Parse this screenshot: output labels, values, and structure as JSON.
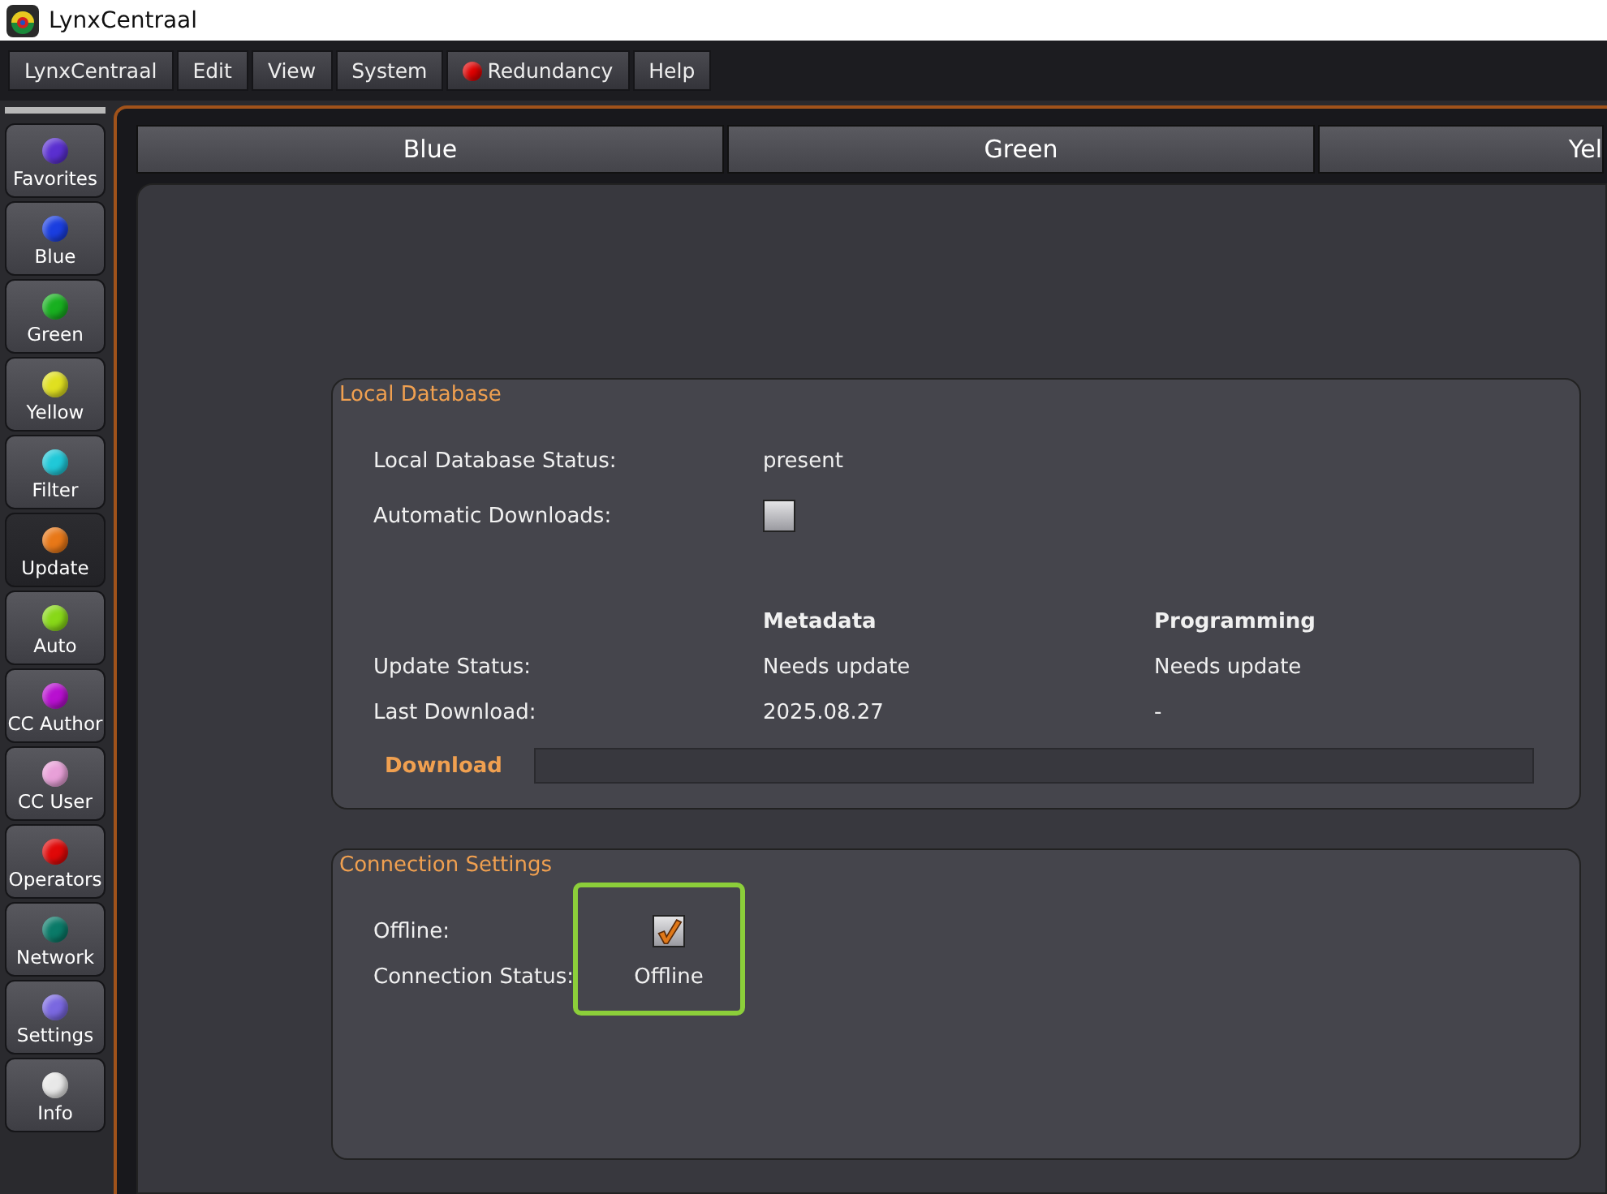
{
  "window": {
    "title": "LynxCentraal"
  },
  "menu": [
    {
      "label": "LynxCentraal",
      "kind": "plain"
    },
    {
      "label": "Edit",
      "kind": "plain"
    },
    {
      "label": "View",
      "kind": "plain"
    },
    {
      "label": "System",
      "kind": "plain"
    },
    {
      "label": "Redundancy",
      "kind": "led",
      "color": "#e00000"
    },
    {
      "label": "Help",
      "kind": "plain"
    }
  ],
  "sidebar": {
    "items": [
      {
        "label": "Favorites",
        "color": "#5a2fd0",
        "selected": false
      },
      {
        "label": "Blue",
        "color": "#1a3ee0",
        "selected": false
      },
      {
        "label": "Green",
        "color": "#18b020",
        "selected": false
      },
      {
        "label": "Yellow",
        "color": "#e0e020",
        "selected": false
      },
      {
        "label": "Filter",
        "color": "#20c8d8",
        "selected": false
      },
      {
        "label": "Update",
        "color": "#e87818",
        "selected": true
      },
      {
        "label": "Auto",
        "color": "#88d818",
        "selected": false
      },
      {
        "label": "CC Author",
        "color": "#b810d0",
        "selected": false
      },
      {
        "label": "CC User",
        "color": "#e8a0d8",
        "selected": false
      },
      {
        "label": "Operators",
        "color": "#e00808",
        "selected": false
      },
      {
        "label": "Network",
        "color": "#0a7a68",
        "selected": false
      },
      {
        "label": "Settings",
        "color": "#7a68e0",
        "selected": false
      },
      {
        "label": "Info",
        "color": "#e8e8e8",
        "selected": false
      }
    ]
  },
  "tabs": [
    {
      "label": "Blue",
      "selected": false
    },
    {
      "label": "Green",
      "selected": false
    },
    {
      "label": "Yel",
      "selected": false
    }
  ],
  "local_database": {
    "title": "Local Database",
    "status_label": "Local Database Status:",
    "status_value": "present",
    "auto_label": "Automatic Downloads:",
    "auto_checked": false,
    "columns": [
      "Metadata",
      "Programming"
    ],
    "rows": [
      {
        "label": "Update Status:",
        "values": [
          "Needs update",
          "Needs update"
        ]
      },
      {
        "label": "Last Download:",
        "values": [
          "2025.08.27",
          "-"
        ]
      }
    ],
    "download_button": "Download",
    "level": 0
  },
  "connection_settings": {
    "title": "Connection Settings",
    "offline_label": "Offline:",
    "offline_checked": true,
    "status_label": "Connection Status:",
    "status_value": "Offline",
    "highlighted": true
  }
}
